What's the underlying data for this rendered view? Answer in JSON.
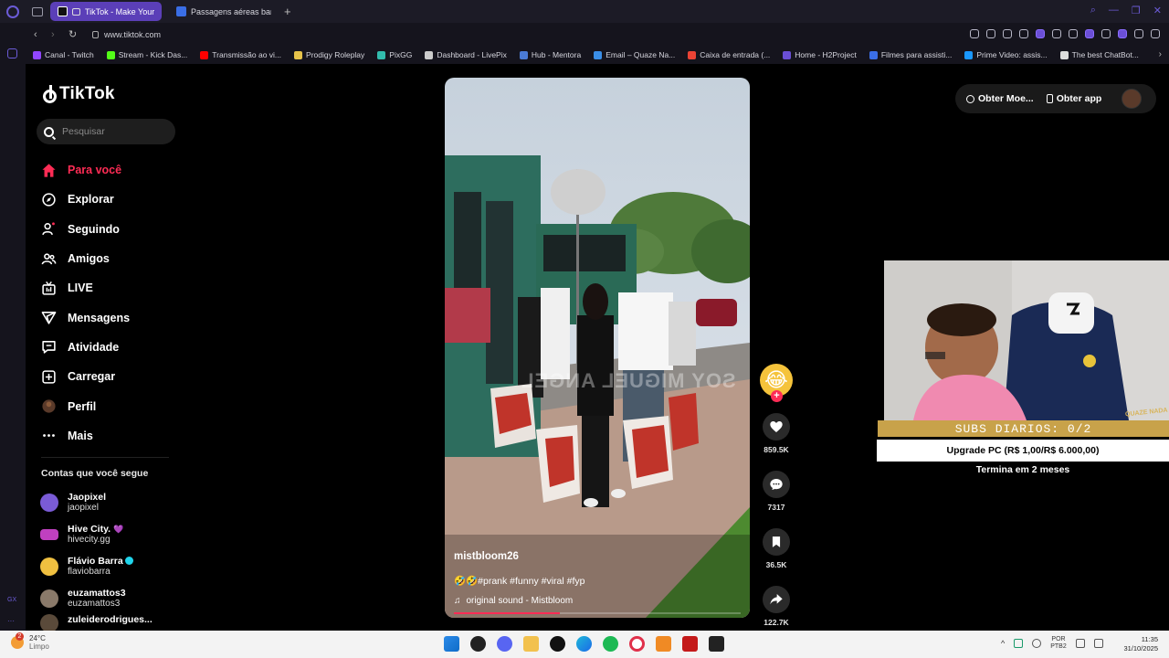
{
  "browser": {
    "tabs": [
      {
        "label": "TikTok - Make Your D",
        "active": true
      },
      {
        "label": "Passagens aéreas barata",
        "active": false
      }
    ],
    "new_tab": "+",
    "url": "www.tiktok.com",
    "bookmarks": [
      {
        "label": "Canal - Twitch",
        "color": "#9146ff"
      },
      {
        "label": "Stream - Kick Das...",
        "color": "#53fc18"
      },
      {
        "label": "Transmissão ao vi...",
        "color": "#ff0000"
      },
      {
        "label": "Prodigy Roleplay",
        "color": "#e6c34a"
      },
      {
        "label": "PixGG",
        "color": "#32bcad"
      },
      {
        "label": "Dashboard - LivePix",
        "color": "#cccccc"
      },
      {
        "label": "Hub - Mentora",
        "color": "#4a7bd6"
      },
      {
        "label": "Email – Quaze Na...",
        "color": "#3a8ee6"
      },
      {
        "label": "Caixa de entrada (...",
        "color": "#ea4335"
      },
      {
        "label": "Home - H2Project",
        "color": "#6a4fd6"
      },
      {
        "label": "Filmes para assisti...",
        "color": "#3a6ee6"
      },
      {
        "label": "Prime Video: assis...",
        "color": "#1a98ff"
      },
      {
        "label": "The best ChatBot...",
        "color": "#dddddd"
      }
    ]
  },
  "sidebar": {
    "logo": "TikTok",
    "search_placeholder": "Pesquisar",
    "menu": [
      {
        "label": "Para você",
        "icon": "home-icon",
        "active": true
      },
      {
        "label": "Explorar",
        "icon": "compass-icon"
      },
      {
        "label": "Seguindo",
        "icon": "following-icon"
      },
      {
        "label": "Amigos",
        "icon": "friends-icon"
      },
      {
        "label": "LIVE",
        "icon": "live-icon"
      },
      {
        "label": "Mensagens",
        "icon": "messages-icon"
      },
      {
        "label": "Atividade",
        "icon": "activity-icon"
      },
      {
        "label": "Carregar",
        "icon": "upload-icon"
      },
      {
        "label": "Perfil",
        "icon": "profile-avatar"
      },
      {
        "label": "Mais",
        "icon": "more-icon"
      }
    ],
    "following_title": "Contas que você segue",
    "following": [
      {
        "name": "Jaopixel",
        "handle": "jaopixel",
        "color": "#7a5bd6"
      },
      {
        "name": "Hive City.",
        "handle": "hivecity.gg",
        "color": "#c040c0"
      },
      {
        "name": "Flávio Barra",
        "handle": "flaviobarra",
        "color": "#f0c040"
      },
      {
        "name": "euzamattos3",
        "handle": "euzamattos3",
        "color": "#8a7a6a"
      },
      {
        "name": "zuleiderodrigues...",
        "handle": "",
        "color": "#5a4a3a"
      }
    ]
  },
  "video": {
    "author": "mistbloom26",
    "caption": "🤣🤣#prank #funny #viral #fyp",
    "sound": "original sound - Mistbloom",
    "watermark": "SOY MIGUEL ANGEL",
    "progress": 0.37
  },
  "actions": {
    "likes": "859.5K",
    "comments": "7317",
    "saves": "36.5K",
    "shares": "122.7K"
  },
  "header": {
    "coins": "Obter Moe...",
    "app": "Obter app"
  },
  "stream_overlay": {
    "subs": "SUBS DIARIOS: 0/2",
    "goal": "Upgrade PC (R$ 1,00/R$ 6.000,00)",
    "goal_sub": "Termina em 2 meses",
    "logo": "QUAZE NADA"
  },
  "taskbar": {
    "temp": "24°C",
    "weather": "Limpo",
    "badge": "2",
    "lang1": "POR",
    "lang2": "PTB2",
    "time": "11:35",
    "date": "31/10/2025"
  },
  "colors": {
    "accent": "#fe2c55",
    "opera": "#5b3fb8"
  }
}
